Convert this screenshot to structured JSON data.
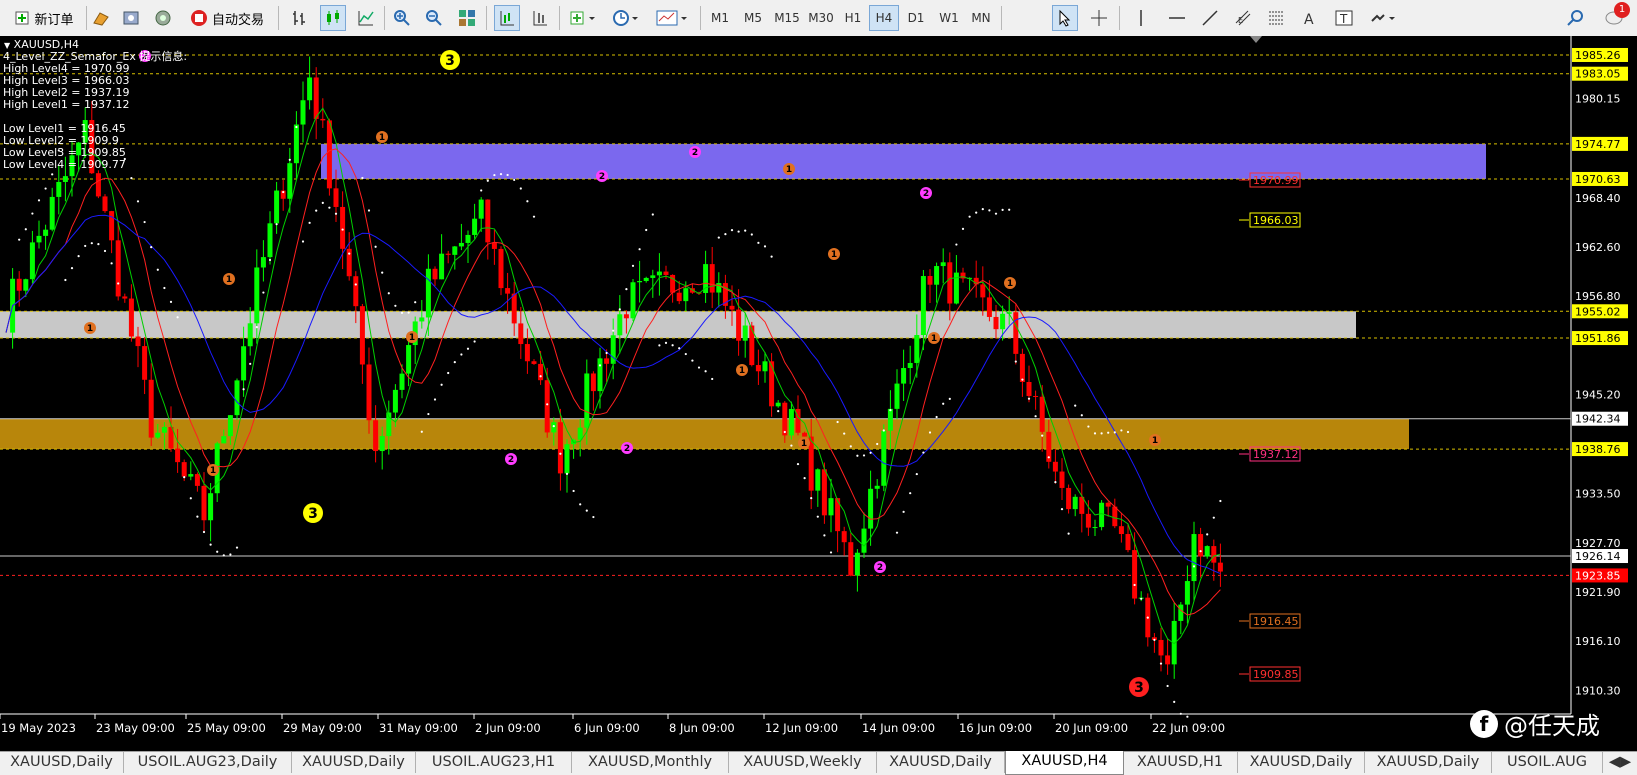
{
  "toolbar": {
    "new_order": "新订单",
    "auto_trade": "自动交易",
    "timeframes": [
      "M1",
      "M5",
      "M15",
      "M30",
      "H1",
      "H4",
      "D1",
      "W1",
      "MN"
    ],
    "active_timeframe": "H4",
    "notification_count": "1"
  },
  "chart": {
    "symbol_title": "XAUUSD,H4",
    "indicator_title": "4_Level_ZZ_Semafor_Ex 提示信息:",
    "info_lines": [
      "High Level4 = 1970.99",
      "High Level3 = 1966.03",
      "High Level2 = 1937.19",
      "High Level1 = 1937.12",
      "",
      "Low Level1 = 1916.45",
      "Low Level2 = 1909.9",
      "Low Level3 = 1909.85",
      "Low Level4 = 1909.77"
    ],
    "y_axis": {
      "min": 1907.5,
      "max": 1987.5
    },
    "price_ticks": [
      "1985.26",
      "1983.05",
      "1980.15",
      "1974.77",
      "1970.63",
      "1968.40",
      "1962.60",
      "1956.80",
      "1955.02",
      "1951.86",
      "1945.20",
      "1942.34",
      "1938.76",
      "1933.50",
      "1927.70",
      "1926.14",
      "1923.85",
      "1921.90",
      "1916.10",
      "1910.30"
    ],
    "highlighted_labels": [
      {
        "text": "1985.26",
        "bg": "#ffff00",
        "fg": "#000000"
      },
      {
        "text": "1983.05",
        "bg": "#ffff00",
        "fg": "#000000"
      },
      {
        "text": "1974.77",
        "bg": "#ffff00",
        "fg": "#000000"
      },
      {
        "text": "1970.63",
        "bg": "#ffff00",
        "fg": "#000000"
      },
      {
        "text": "1955.02",
        "bg": "#ffff00",
        "fg": "#000000"
      },
      {
        "text": "1951.86",
        "bg": "#ffff00",
        "fg": "#000000"
      },
      {
        "text": "1942.34",
        "bg": "#ffffff",
        "fg": "#000000"
      },
      {
        "text": "1938.76",
        "bg": "#ffff00",
        "fg": "#000000"
      },
      {
        "text": "1926.14",
        "bg": "#ffffff",
        "fg": "#000000"
      },
      {
        "text": "1923.85",
        "bg": "#ff0000",
        "fg": "#ffffff"
      }
    ],
    "level_labels": [
      {
        "text": "1970.99",
        "color": "#ff3030"
      },
      {
        "text": "1966.03",
        "color": "#ffff00"
      },
      {
        "text": "1937.12",
        "color": "#ff3080"
      },
      {
        "text": "1916.45",
        "color": "#e07020"
      },
      {
        "text": "1909.85",
        "color": "#ff3030"
      }
    ],
    "zones": [
      {
        "name": "purple-zone",
        "top": 1974.77,
        "bottom": 1970.63,
        "color": "#7b68ee"
      },
      {
        "name": "gray-zone",
        "top": 1955.02,
        "bottom": 1951.86,
        "color": "#c8c8c8"
      },
      {
        "name": "gold-zone",
        "top": 1942.34,
        "bottom": 1938.76,
        "color": "#b8860b"
      }
    ],
    "date_labels": [
      "19 May 2023",
      "23 May 09:00",
      "25 May 09:00",
      "29 May 09:00",
      "31 May 09:00",
      "2 Jun 09:00",
      "6 Jun 09:00",
      "8 Jun 09:00",
      "12 Jun 09:00",
      "14 Jun 09:00",
      "16 Jun 09:00",
      "20 Jun 09:00",
      "22 Jun 09:00"
    ],
    "semafor_markers": [
      "1",
      "2",
      "3"
    ]
  },
  "tabs": [
    "XAUUSD,Daily",
    "USOIL.AUG23,Daily",
    "XAUUSD,Daily",
    "USOIL.AUG23,H1",
    "XAUUSD,Monthly",
    "XAUUSD,Weekly",
    "XAUUSD,Daily",
    "XAUUSD,H4",
    "XAUUSD,H1",
    "XAUUSD,Daily",
    "XAUUSD,Daily",
    "USOIL.AUG"
  ],
  "active_tab": "XAUUSD,H4",
  "watermark": "@任天成",
  "colors": {
    "bull": "#00ff00",
    "bear": "#ff0000",
    "ma_fast": "#00d000",
    "ma_mid": "#ff2020",
    "ma_slow": "#1a1aff",
    "sar": "#ffffff"
  }
}
